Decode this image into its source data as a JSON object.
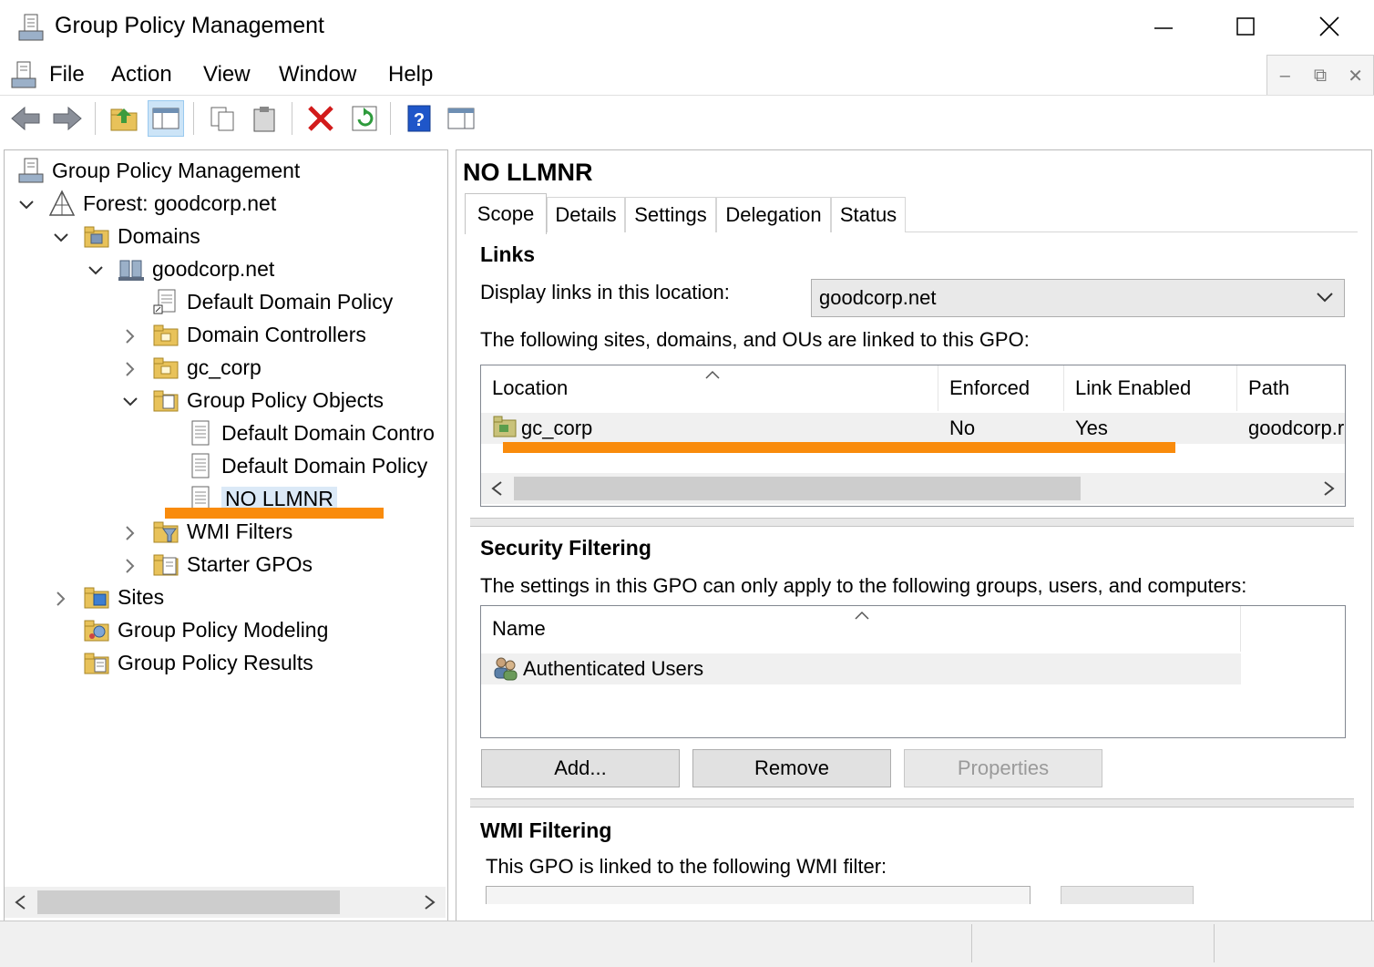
{
  "window": {
    "title": "Group Policy Management"
  },
  "menu": {
    "items": [
      "File",
      "Action",
      "View",
      "Window",
      "Help"
    ]
  },
  "tree": {
    "root": "Group Policy Management",
    "forest": "Forest: goodcorp.net",
    "domains": "Domains",
    "domain": "goodcorp.net",
    "default_domain_policy": "Default Domain Policy",
    "domain_controllers": "Domain Controllers",
    "gc_corp": "gc_corp",
    "gpo_container": "Group Policy Objects",
    "gpo_default_dc": "Default Domain Contro",
    "gpo_default_domain": "Default Domain Policy",
    "gpo_no_llmnr": "NO LLMNR",
    "wmi_filters": "WMI Filters",
    "starter_gpos": "Starter GPOs",
    "sites": "Sites",
    "modeling": "Group Policy Modeling",
    "results": "Group Policy Results"
  },
  "detail": {
    "title": "NO LLMNR",
    "tabs": [
      "Scope",
      "Details",
      "Settings",
      "Delegation",
      "Status"
    ],
    "links": {
      "heading": "Links",
      "display_label": "Display links in this location:",
      "location_value": "goodcorp.net",
      "description": "The following sites, domains, and OUs are linked to this GPO:",
      "columns": [
        "Location",
        "Enforced",
        "Link Enabled",
        "Path"
      ],
      "rows": [
        {
          "location": "gc_corp",
          "enforced": "No",
          "link_enabled": "Yes",
          "path": "goodcorp.r"
        }
      ]
    },
    "security": {
      "heading": "Security Filtering",
      "description": "The settings in this GPO can only apply to the following groups, users, and computers:",
      "columns": [
        "Name"
      ],
      "rows": [
        "Authenticated Users"
      ],
      "buttons": {
        "add": "Add...",
        "remove": "Remove",
        "properties": "Properties"
      }
    },
    "wmi": {
      "heading": "WMI Filtering",
      "description": "This GPO is linked to the following WMI filter:"
    }
  },
  "colors": {
    "highlight": "#f98b0c",
    "selection": "#dbe9f7"
  }
}
